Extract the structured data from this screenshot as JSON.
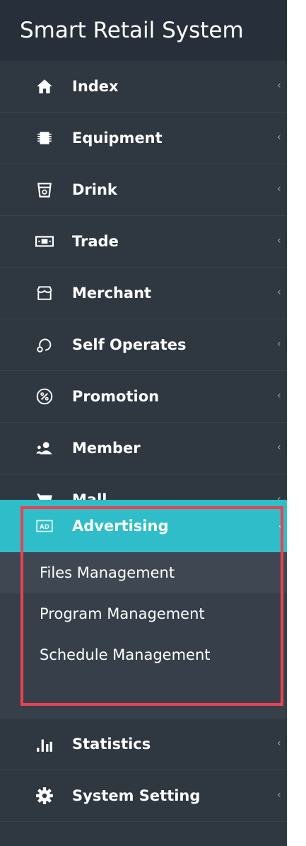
{
  "brand": {
    "title": "Smart Retail System"
  },
  "menu": [
    {
      "label": "Index",
      "icon": "home-icon",
      "chevron": "‹"
    },
    {
      "label": "Equipment",
      "icon": "chip-icon",
      "chevron": "‹"
    },
    {
      "label": "Drink",
      "icon": "cup-icon",
      "chevron": "‹"
    },
    {
      "label": "Trade",
      "icon": "money-icon",
      "chevron": "‹"
    },
    {
      "label": "Merchant",
      "icon": "store-icon",
      "chevron": "‹"
    },
    {
      "label": "Self Operates",
      "icon": "loop-icon",
      "chevron": "‹"
    },
    {
      "label": "Promotion",
      "icon": "discount-icon",
      "chevron": "‹"
    },
    {
      "label": "Member",
      "icon": "users-icon",
      "chevron": "‹"
    },
    {
      "label": "Mall",
      "icon": "cart-icon",
      "chevron": "‹"
    },
    {
      "label": "Advertising",
      "icon": "ad-icon",
      "chevron": "⌄"
    },
    {
      "label": "Statistics",
      "icon": "bar-chart-icon",
      "chevron": "‹"
    },
    {
      "label": "System Setting",
      "icon": "gear-icon",
      "chevron": "‹"
    }
  ],
  "submenu": [
    {
      "label": "Files Management"
    },
    {
      "label": "Program Management"
    },
    {
      "label": "Schedule Management"
    }
  ],
  "colors": {
    "sidebar_bg": "#2f3741",
    "brand_bg": "#27303a",
    "active_bg": "#2fbdc9",
    "submenu_bg": "#363f4a",
    "highlight_border": "#e8434f"
  }
}
